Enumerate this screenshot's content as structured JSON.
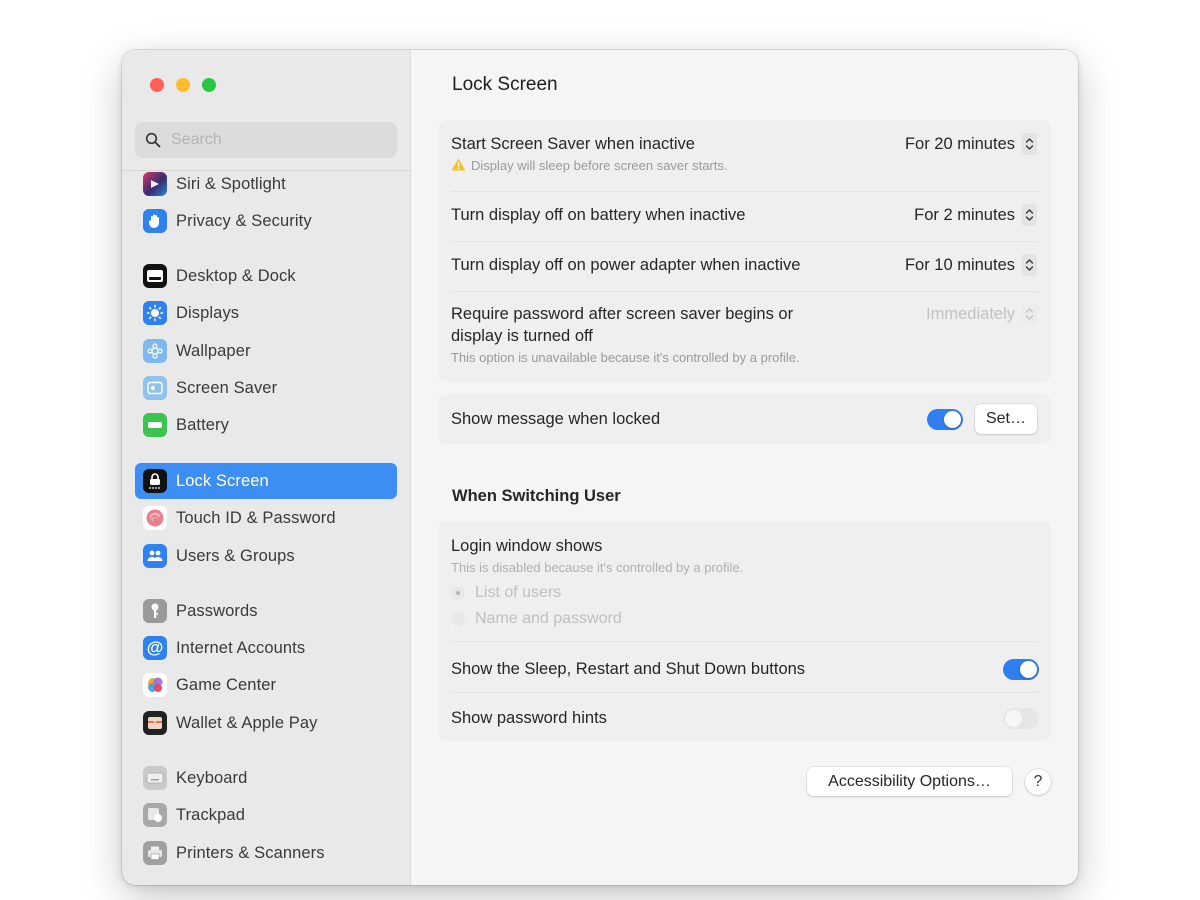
{
  "window": {
    "traffic_lights": [
      "close",
      "minimize",
      "maximize"
    ]
  },
  "sidebar": {
    "search": {
      "placeholder": "Search",
      "value": ""
    },
    "items": [
      {
        "label": "Siri & Spotlight",
        "icon": "siri-icon",
        "active": false
      },
      {
        "label": "Privacy & Security",
        "icon": "hand-icon",
        "active": false
      },
      {
        "label": "Desktop & Dock",
        "icon": "dock-icon",
        "active": false
      },
      {
        "label": "Displays",
        "icon": "sun-icon",
        "active": false
      },
      {
        "label": "Wallpaper",
        "icon": "wallpaper-icon",
        "active": false
      },
      {
        "label": "Screen Saver",
        "icon": "screen-saver-icon",
        "active": false
      },
      {
        "label": "Battery",
        "icon": "battery-icon",
        "active": false
      },
      {
        "label": "Lock Screen",
        "icon": "lock-icon",
        "active": true
      },
      {
        "label": "Touch ID & Password",
        "icon": "fingerprint-icon",
        "active": false
      },
      {
        "label": "Users & Groups",
        "icon": "users-icon",
        "active": false
      },
      {
        "label": "Passwords",
        "icon": "key-icon",
        "active": false
      },
      {
        "label": "Internet Accounts",
        "icon": "at-icon",
        "active": false
      },
      {
        "label": "Game Center",
        "icon": "game-center-icon",
        "active": false
      },
      {
        "label": "Wallet & Apple Pay",
        "icon": "wallet-icon",
        "active": false
      },
      {
        "label": "Keyboard",
        "icon": "keyboard-icon",
        "active": false
      },
      {
        "label": "Trackpad",
        "icon": "trackpad-icon",
        "active": false
      },
      {
        "label": "Printers & Scanners",
        "icon": "printer-icon",
        "active": false
      }
    ]
  },
  "main": {
    "title": "Lock Screen",
    "settings": {
      "screen_saver": {
        "label": "Start Screen Saver when inactive",
        "warning": "Display will sleep before screen saver starts.",
        "value": "For 20 minutes"
      },
      "display_battery": {
        "label": "Turn display off on battery when inactive",
        "value": "For 2 minutes"
      },
      "display_power": {
        "label": "Turn display off on power adapter when inactive",
        "value": "For 10 minutes"
      },
      "require_password": {
        "label_line1": "Require password after screen saver begins or",
        "label_line2": "display is turned off",
        "note": "This option is unavailable because it's controlled by a profile.",
        "value": "Immediately",
        "disabled": true
      }
    },
    "message": {
      "label": "Show message when locked",
      "enabled": true,
      "set_button": "Set…"
    },
    "switching_user": {
      "title": "When Switching User",
      "login_window": {
        "label": "Login window shows",
        "note": "This is disabled because it's controlled by a profile.",
        "options": [
          {
            "label": "List of users",
            "selected": true
          },
          {
            "label": "Name and password",
            "selected": false
          }
        ]
      },
      "sleep_restart": {
        "label": "Show the Sleep, Restart and Shut Down buttons",
        "enabled": true
      },
      "password_hints": {
        "label": "Show password hints",
        "enabled": false
      }
    },
    "footer": {
      "accessibility_button": "Accessibility Options…",
      "help_button": "?"
    }
  }
}
